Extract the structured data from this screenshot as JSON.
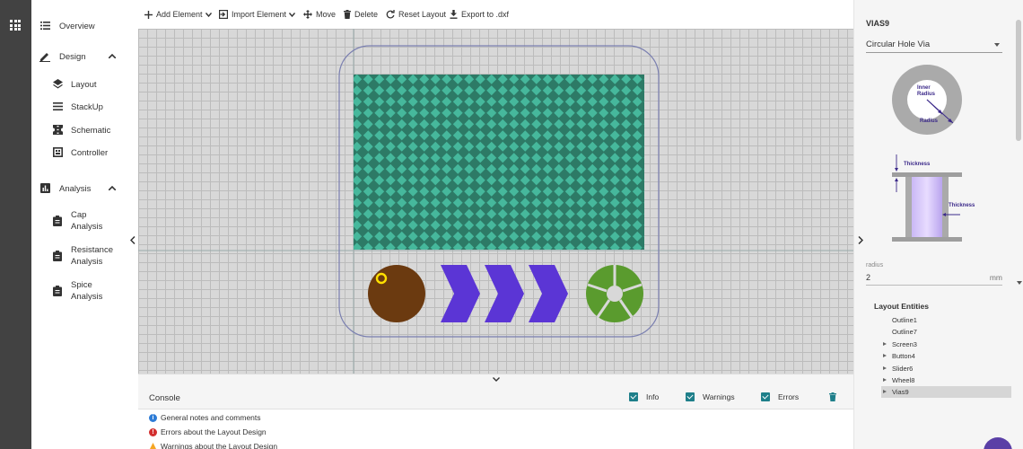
{
  "nav": {
    "overview": "Overview",
    "design": "Design",
    "design_items": [
      "Layout",
      "StackUp",
      "Schematic",
      "Controller"
    ],
    "analysis": "Analysis",
    "analysis_items": [
      {
        "line1": "Cap",
        "line2": "Analysis"
      },
      {
        "line1": "Resistance",
        "line2": "Analysis"
      },
      {
        "line1": "Spice",
        "line2": "Analysis"
      }
    ]
  },
  "toolbar": {
    "add_element": "Add Element",
    "import_element": "Import Element",
    "move": "Move",
    "delete": "Delete",
    "reset_layout": "Reset Layout",
    "export": "Export to .dxf"
  },
  "console": {
    "title": "Console",
    "filters": {
      "info": "Info",
      "warnings": "Warnings",
      "errors": "Errors"
    },
    "messages": [
      {
        "type": "info",
        "text": "General notes and comments"
      },
      {
        "type": "error",
        "text": "Errors about the Layout Design"
      },
      {
        "type": "warning",
        "text": "Warnings about the Layout Design"
      }
    ]
  },
  "properties": {
    "title": "VIAS9",
    "via_type": "Circular Hole Via",
    "diagram": {
      "inner_radius_l1": "Inner",
      "inner_radius_l2": "Radius",
      "radius": "Radius",
      "thickness_top": "Thickness",
      "thickness_side": "Thickness"
    },
    "radius_label": "radius",
    "radius_value": "2",
    "radius_unit": "mm"
  },
  "entities": {
    "title": "Layout Entities",
    "items": [
      {
        "label": "Outline1",
        "expandable": false,
        "selected": false
      },
      {
        "label": "Outline7",
        "expandable": false,
        "selected": false
      },
      {
        "label": "Screen3",
        "expandable": true,
        "selected": false
      },
      {
        "label": "Button4",
        "expandable": true,
        "selected": false
      },
      {
        "label": "Slider6",
        "expandable": true,
        "selected": false
      },
      {
        "label": "Wheel8",
        "expandable": true,
        "selected": false
      },
      {
        "label": "Vias9",
        "expandable": true,
        "selected": true
      }
    ]
  },
  "colors": {
    "accent": "#1e7f8a",
    "screen_light": "#46b89c",
    "screen_dark": "#2d7a66",
    "button": "#6b3a10",
    "via_ring": "#ffe000",
    "slider": "#5b35d5",
    "wheel": "#5a9b2e",
    "outline": "#7a7fb0"
  }
}
